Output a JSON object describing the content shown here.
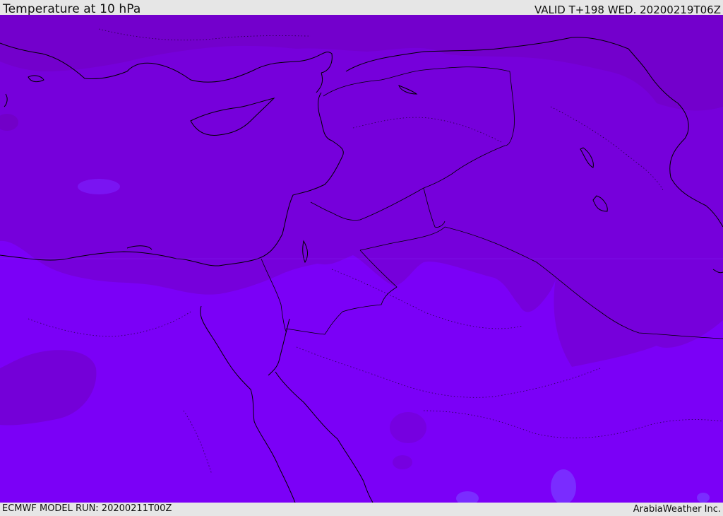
{
  "header": {
    "title": "Temperature at 10 hPa",
    "valid_time": "VALID T+198 WED. 20200219T06Z"
  },
  "footer": {
    "model_run": "ECMWF MODEL RUN: 20200211T00Z",
    "credit": "ArabiaWeather Inc."
  },
  "map": {
    "variable": "Temperature",
    "level": "10 hPa",
    "colors": {
      "warm_band": "#7300cf",
      "main_field": "#7b00f7",
      "warmer_patches": "#7400d8",
      "cool_patches": "#7a24ff",
      "borders": "#000000"
    }
  }
}
